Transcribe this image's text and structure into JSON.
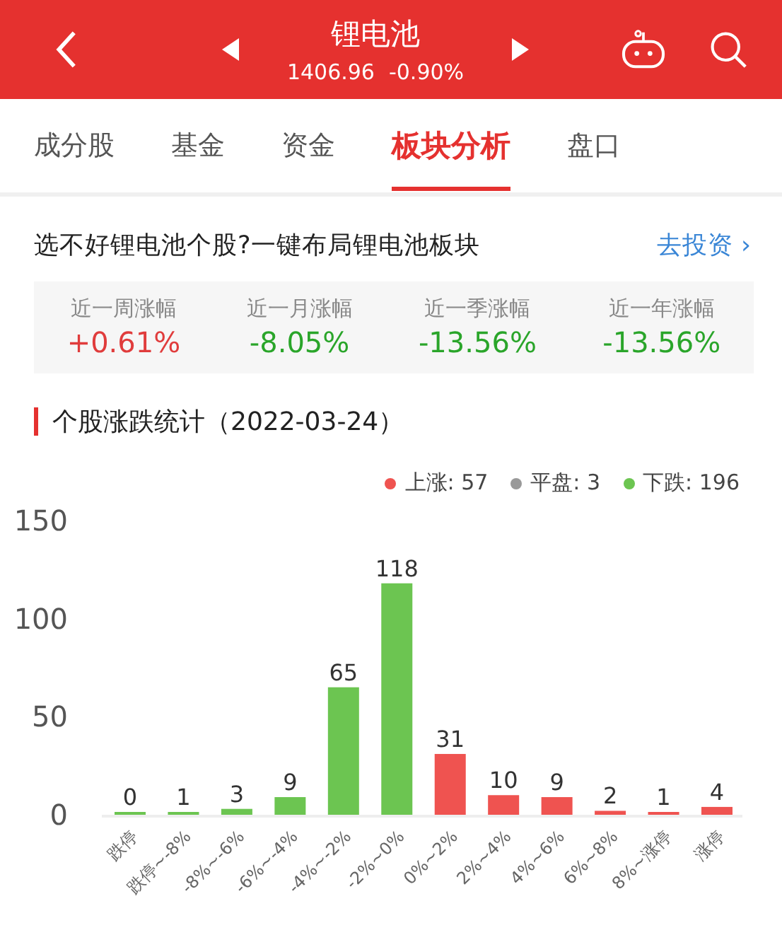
{
  "header": {
    "title": "锂电池",
    "price": "1406.96",
    "change": "-0.90%"
  },
  "tabs": [
    {
      "label": "成分股",
      "selected": false
    },
    {
      "label": "基金",
      "selected": false
    },
    {
      "label": "资金",
      "selected": false
    },
    {
      "label": "板块分析",
      "selected": true
    },
    {
      "label": "盘口",
      "selected": false
    }
  ],
  "promo": {
    "text": "选不好锂电池个股?一键布局锂电池板块",
    "link": "去投资 ›"
  },
  "periods": [
    {
      "label": "近一周涨幅",
      "value": "+0.61%",
      "color": "#e03c3c"
    },
    {
      "label": "近一月涨幅",
      "value": "-8.05%",
      "color": "#2aa52a"
    },
    {
      "label": "近一季涨幅",
      "value": "-13.56%",
      "color": "#2aa52a"
    },
    {
      "label": "近一年涨幅",
      "value": "-13.56%",
      "color": "#2aa52a"
    }
  ],
  "section_title": "个股涨跌统计（2022-03-24）",
  "legend": [
    {
      "label": "上涨: 57",
      "color": "#ef5350"
    },
    {
      "label": "平盘: 3",
      "color": "#999999"
    },
    {
      "label": "下跌: 196",
      "color": "#6cc551"
    }
  ],
  "chart_data": {
    "type": "bar",
    "stacked": true,
    "data_labels": true,
    "ylim": [
      0,
      150
    ],
    "yticks": [
      0,
      50,
      100,
      150
    ],
    "categories": [
      "跌停",
      "跌停~-8%",
      "-8%~-6%",
      "-6%~-4%",
      "-4%~-2%",
      "-2%~0%",
      "0%~2%",
      "2%~4%",
      "4%~6%",
      "6%~8%",
      "8%~涨停",
      "涨停"
    ],
    "series": [
      {
        "color": "#6cc551",
        "values": [
          0,
          1,
          3,
          9,
          65,
          118,
          null,
          null,
          null,
          null,
          null,
          null
        ]
      },
      {
        "color": "#ef5350",
        "values": [
          null,
          null,
          null,
          null,
          null,
          null,
          31,
          10,
          9,
          2,
          1,
          4
        ]
      }
    ]
  }
}
